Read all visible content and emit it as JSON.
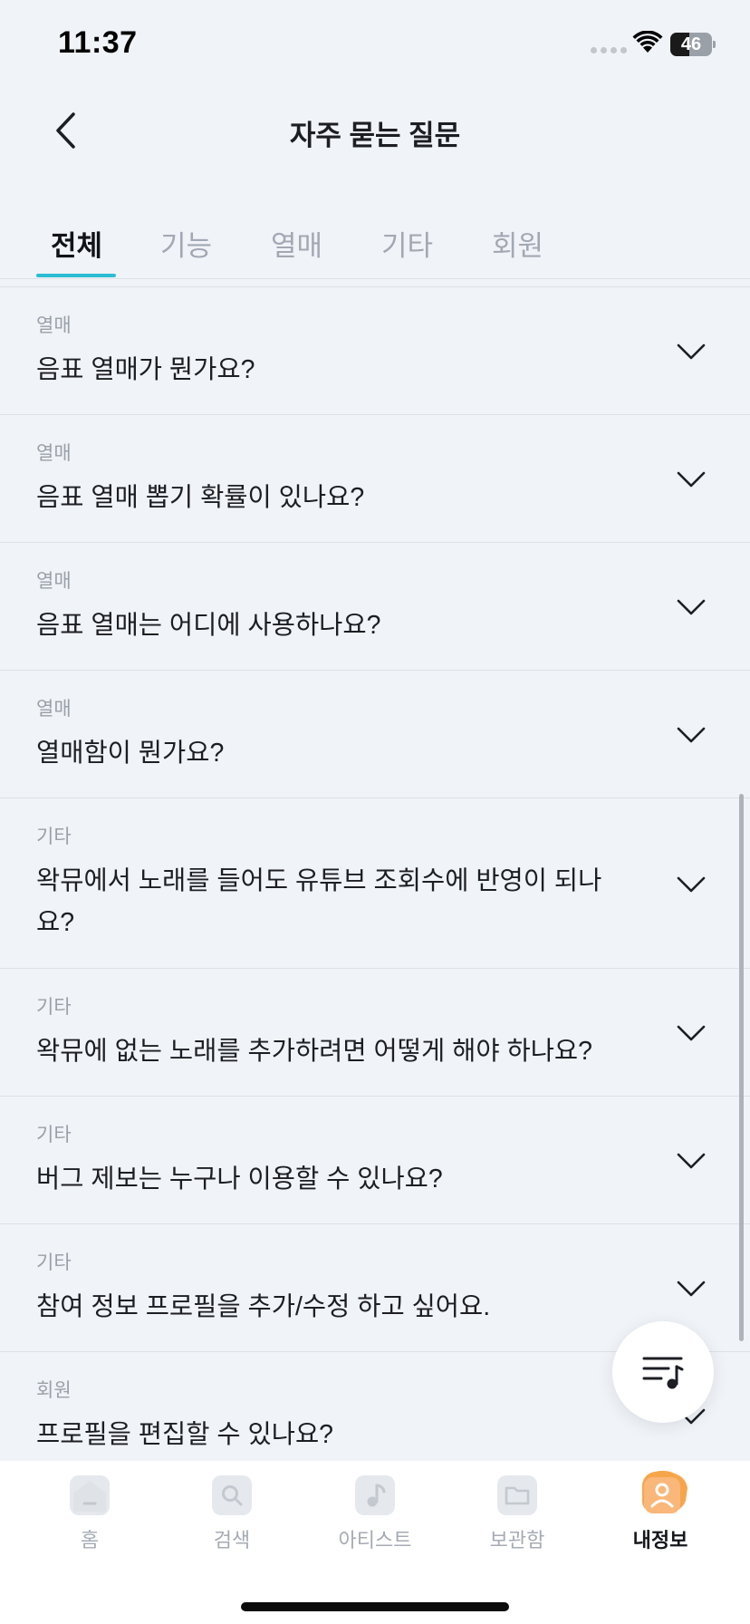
{
  "status_bar": {
    "time": "11:37",
    "battery": "46",
    "battery_level": 0.46
  },
  "nav": {
    "title": "자주 묻는 질문"
  },
  "tabs": [
    {
      "label": "전체",
      "active": true
    },
    {
      "label": "기능",
      "active": false
    },
    {
      "label": "열매",
      "active": false
    },
    {
      "label": "기타",
      "active": false
    },
    {
      "label": "회원",
      "active": false
    }
  ],
  "faq": [
    {
      "category": "열매",
      "question": "음표 열매가 뭔가요?"
    },
    {
      "category": "열매",
      "question": "음표 열매 뽑기 확률이 있나요?"
    },
    {
      "category": "열매",
      "question": "음표 열매는 어디에 사용하나요?"
    },
    {
      "category": "열매",
      "question": "열매함이 뭔가요?"
    },
    {
      "category": "기타",
      "question": "왁뮤에서 노래를 들어도 유튜브 조회수에 반영이 되나요?"
    },
    {
      "category": "기타",
      "question": "왁뮤에 없는 노래를 추가하려면 어떻게 해야 하나요?"
    },
    {
      "category": "기타",
      "question": "버그 제보는 누구나 이용할 수 있나요?"
    },
    {
      "category": "기타",
      "question": "참여 정보 프로필을 추가/수정 하고 싶어요."
    },
    {
      "category": "회원",
      "question": "프로필을 편집할 수 있나요?"
    }
  ],
  "bottom_nav": [
    {
      "label": "홈",
      "icon": "home-icon",
      "active": false
    },
    {
      "label": "검색",
      "icon": "search-icon",
      "active": false
    },
    {
      "label": "아티스트",
      "icon": "music-note-icon",
      "active": false
    },
    {
      "label": "보관함",
      "icon": "folder-icon",
      "active": false
    },
    {
      "label": "내정보",
      "icon": "profile-icon",
      "active": true
    }
  ],
  "colors": {
    "accent": "#2bbdd3",
    "background": "#f0f3f7",
    "profile_accent": "#f7a54b"
  }
}
